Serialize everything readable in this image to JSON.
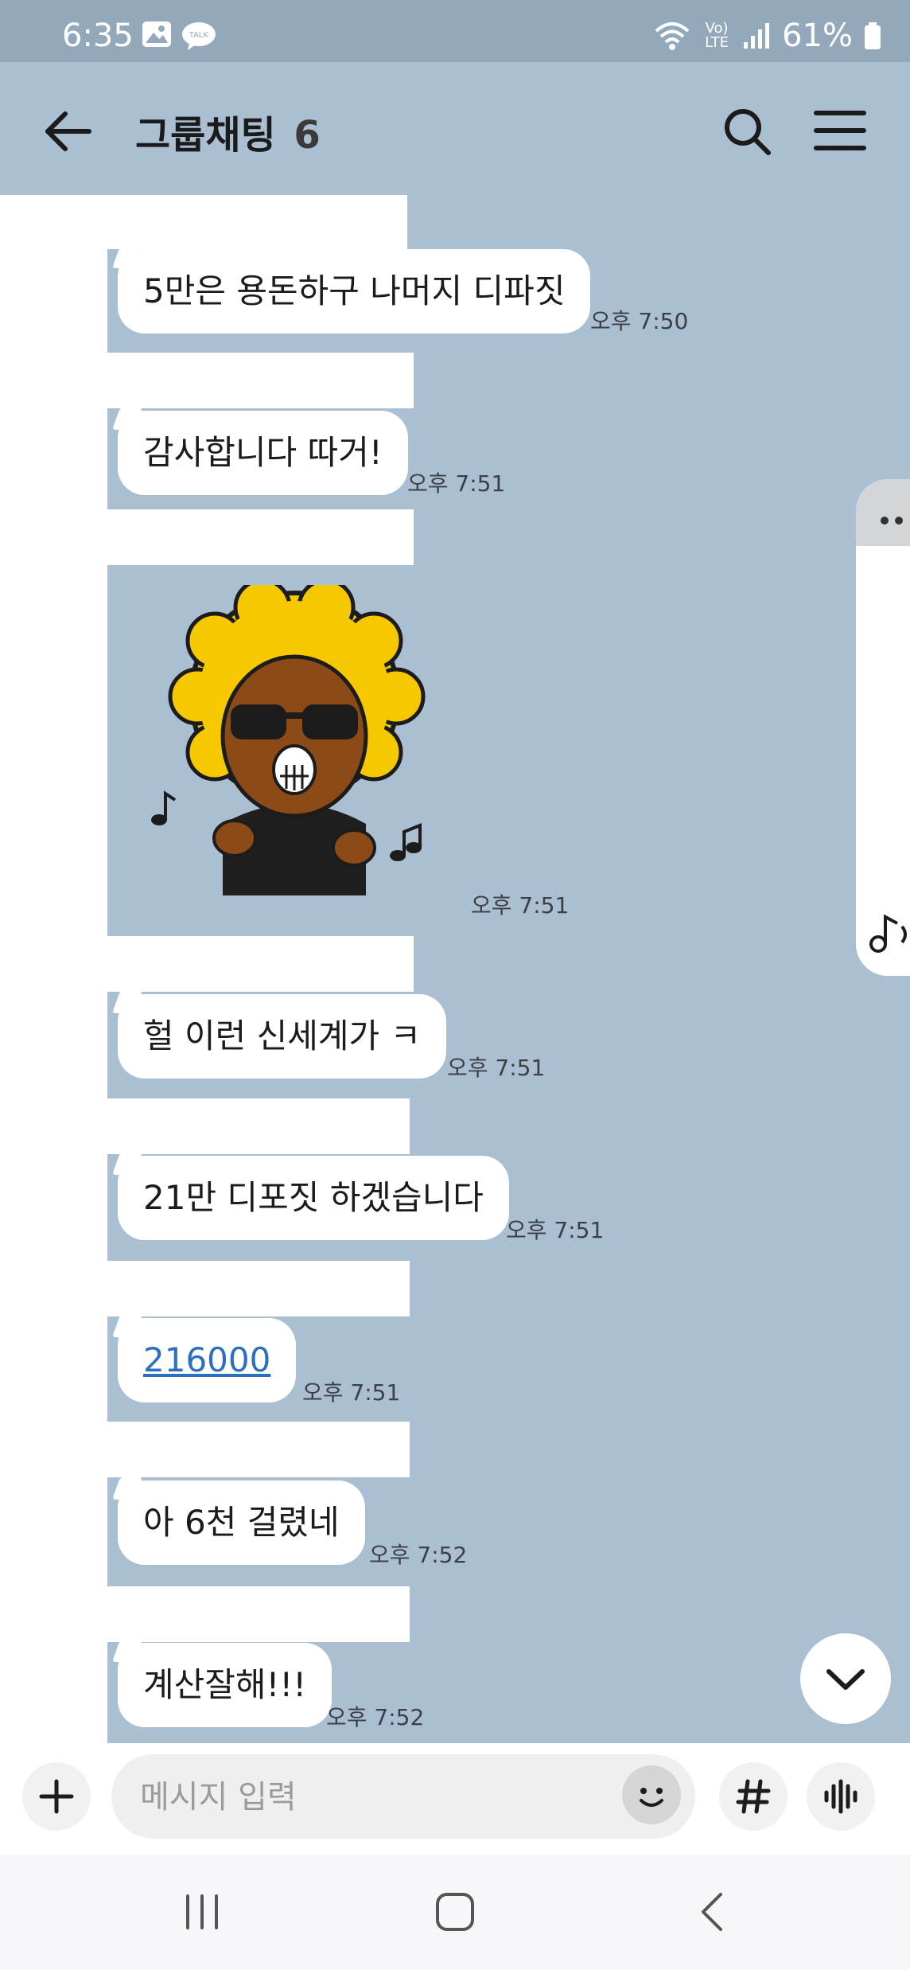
{
  "status_bar": {
    "time": "6:35",
    "battery": "61%",
    "network_label": "Vo) LTE"
  },
  "header": {
    "title": "그룹채팅",
    "member_count": "6"
  },
  "messages": [
    {
      "text": "5만은 용돈하구 나머지 디파짓",
      "time": "오후 7:50"
    },
    {
      "text": "감사합니다 따거!",
      "time": "오후 7:51"
    },
    {
      "type": "sticker",
      "sticker": "afro-character-sticker",
      "time": "오후 7:51"
    },
    {
      "text": "헐 이런 신세계가 ㅋ",
      "time": "오후 7:51"
    },
    {
      "text": "21만 디포짓 하겠습니다",
      "time": "오후 7:51"
    },
    {
      "text": "216000",
      "time": "오후 7:51",
      "link": true
    },
    {
      "text": "아 6천 걸렸네",
      "time": "오후 7:52"
    },
    {
      "text": "계산잘해!!!",
      "time": "오후 7:52"
    }
  ],
  "input": {
    "placeholder": "메시지 입력"
  },
  "colors": {
    "chat_background": "#aabfd2",
    "bubble": "#ffffff",
    "link": "#2b6fbf"
  }
}
